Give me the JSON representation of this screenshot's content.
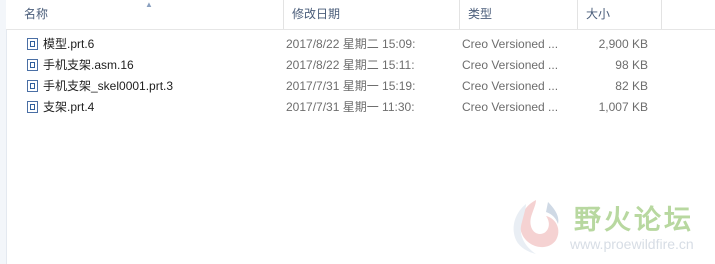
{
  "columns": {
    "name": "名称",
    "date": "修改日期",
    "type": "类型",
    "size": "大小"
  },
  "sort_indicator": "▲",
  "files": [
    {
      "name": "模型.prt.6",
      "date": "2017/8/22 星期二 15:09:",
      "type": "Creo Versioned ...",
      "size": "2,900 KB",
      "icon": "creo-file-icon"
    },
    {
      "name": "手机支架.asm.16",
      "date": "2017/8/22 星期二 15:11:",
      "type": "Creo Versioned ...",
      "size": "98 KB",
      "icon": "creo-file-icon"
    },
    {
      "name": "手机支架_skel0001.prt.3",
      "date": "2017/7/31 星期一 15:19:",
      "type": "Creo Versioned ...",
      "size": "82 KB",
      "icon": "creo-file-icon"
    },
    {
      "name": "支架.prt.4",
      "date": "2017/7/31 星期一 11:30:",
      "type": "Creo Versioned ...",
      "size": "1,007 KB",
      "icon": "creo-file-icon"
    }
  ],
  "watermark": {
    "title": "野火论坛",
    "url": "www.proewildfire.cn"
  }
}
